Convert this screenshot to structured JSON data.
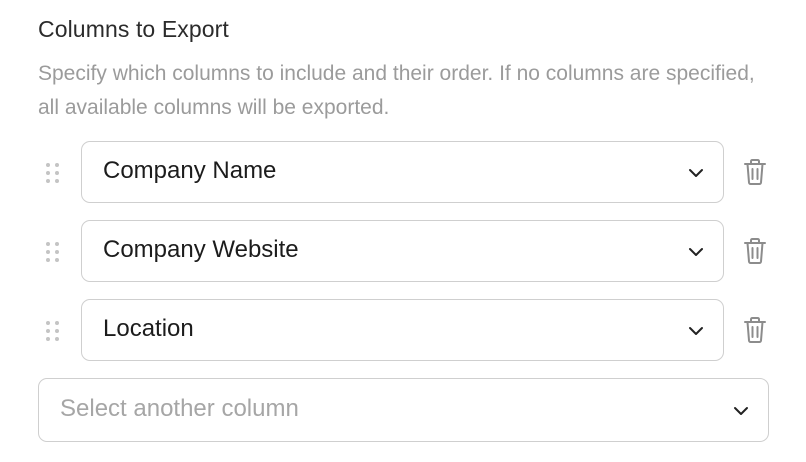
{
  "section": {
    "title": "Columns to Export",
    "description": "Specify which columns to include and their order. If no columns are specified, all available columns will be exported."
  },
  "columns": [
    {
      "label": "Company Name"
    },
    {
      "label": "Company Website"
    },
    {
      "label": "Location"
    }
  ],
  "add_column": {
    "placeholder": "Select another column"
  },
  "icons": {
    "drag": "drag-handle-icon",
    "chevron": "chevron-down-icon",
    "delete": "trash-icon"
  },
  "colors": {
    "border": "#cfcfcf",
    "muted_text": "#9b9b9b",
    "icon": "#8c8c8c",
    "text": "#1c1c1c"
  }
}
